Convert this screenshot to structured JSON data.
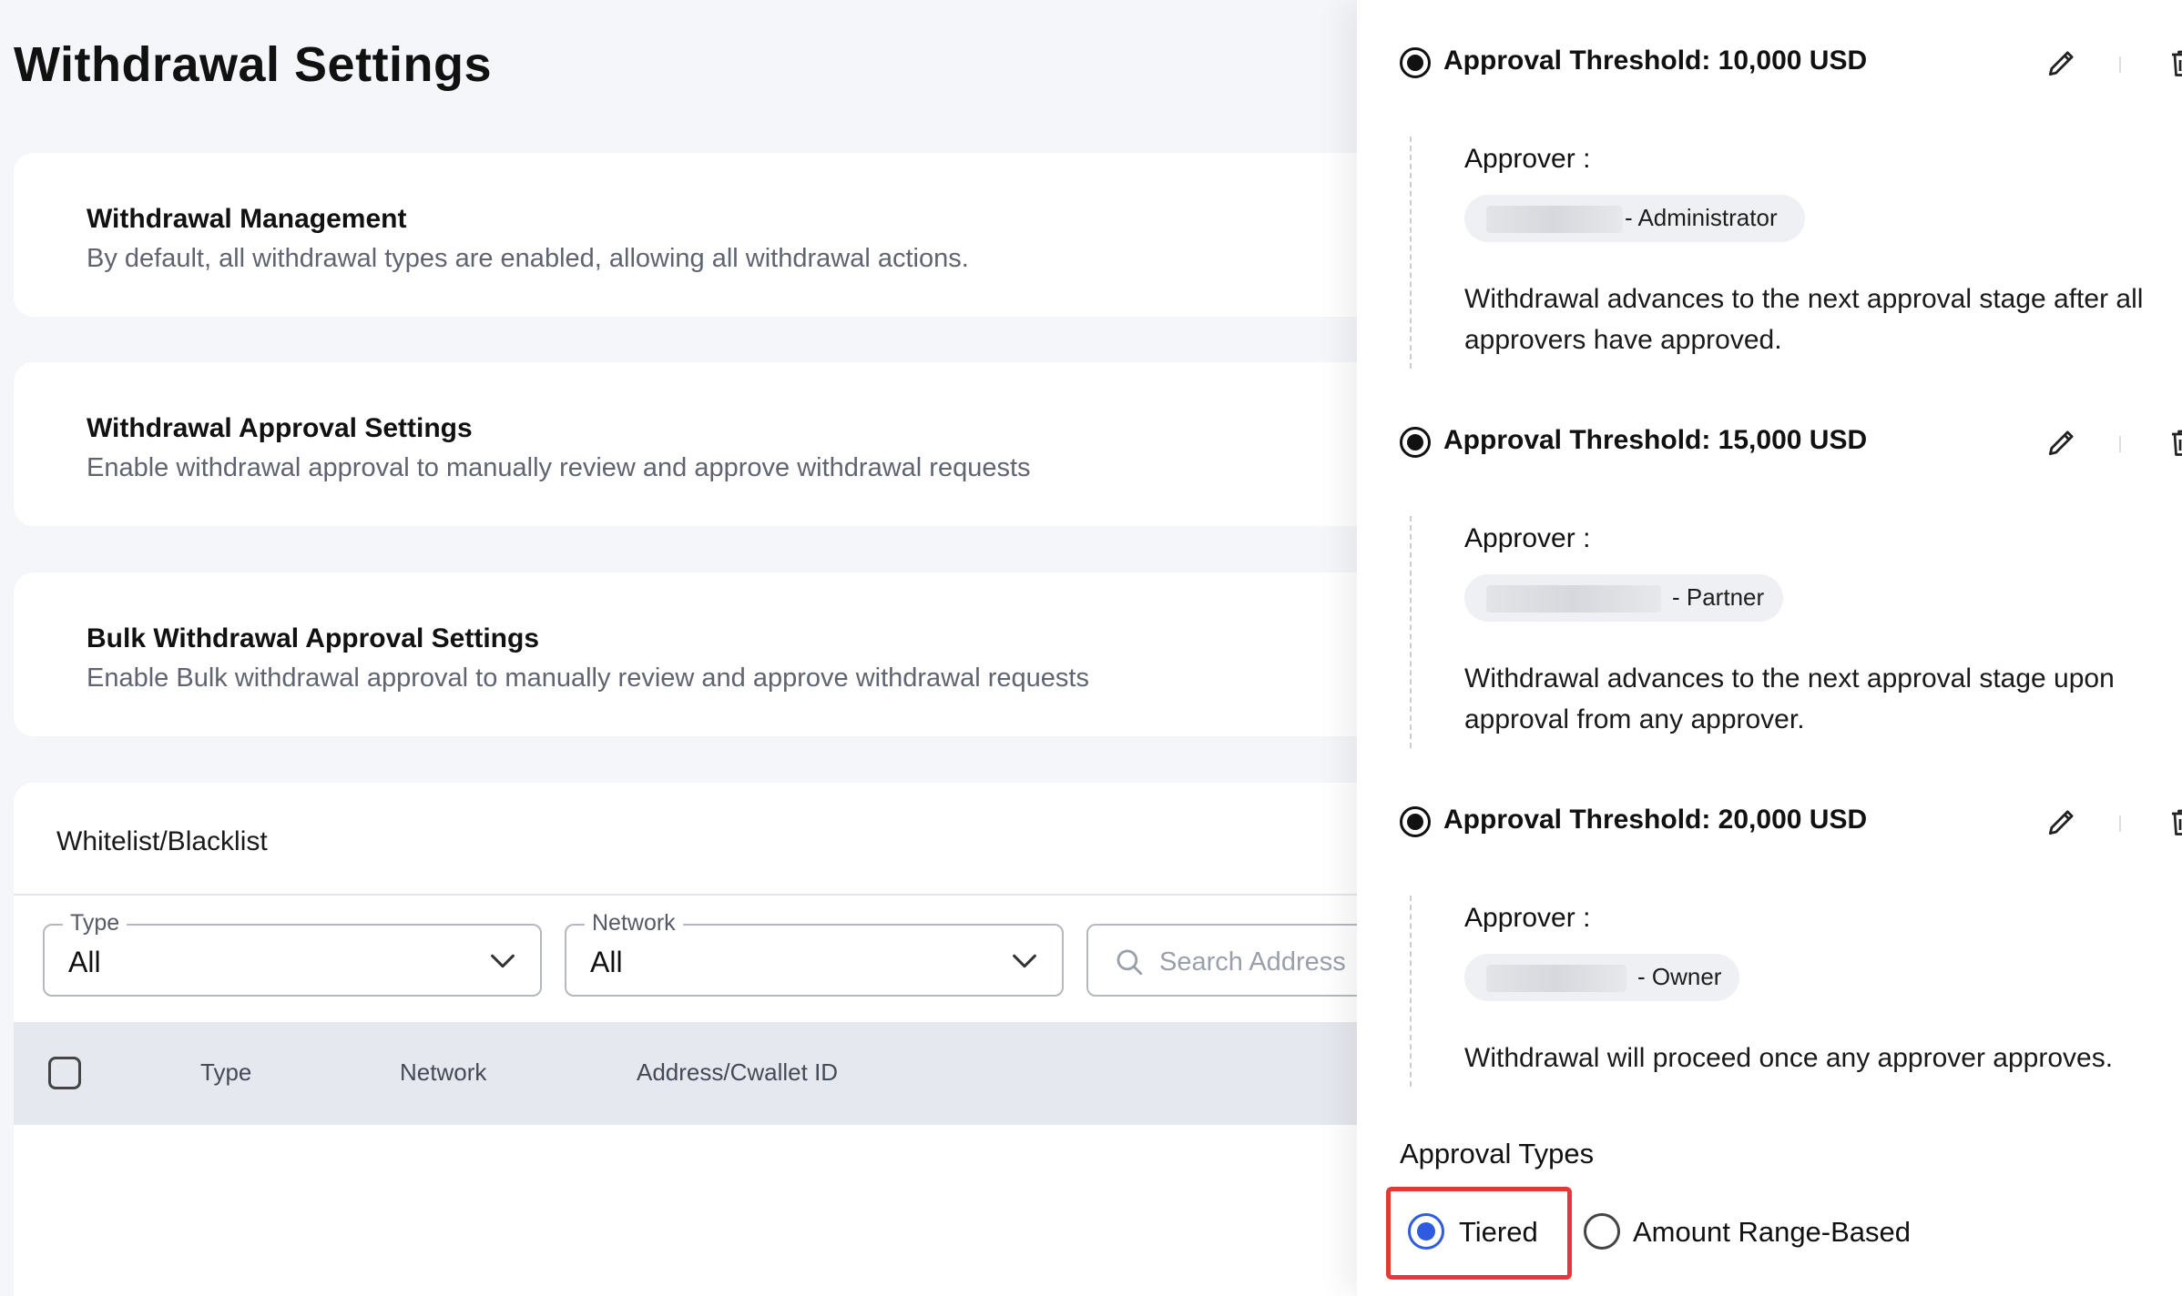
{
  "page": {
    "title": "Withdrawal Settings"
  },
  "cards": [
    {
      "title": "Withdrawal Management",
      "description": "By default, all withdrawal types are enabled, allowing all withdrawal actions."
    },
    {
      "title": "Withdrawal Approval Settings",
      "description": "Enable withdrawal approval to manually review and approve withdrawal requests"
    },
    {
      "title": "Bulk Withdrawal Approval Settings",
      "description": "Enable Bulk withdrawal approval to manually review and approve withdrawal requests"
    }
  ],
  "whitelist": {
    "title": "Whitelist/Blacklist",
    "filters": {
      "type": {
        "label": "Type",
        "value": "All"
      },
      "network": {
        "label": "Network",
        "value": "All"
      },
      "search_placeholder": "Search Address"
    },
    "columns": [
      "Type",
      "Network",
      "Address/Cwallet ID"
    ]
  },
  "approval_rules": [
    {
      "threshold": "Approval Threshold: 10,000 USD",
      "approver_label": "Approver :",
      "approver_role": "- Administrator",
      "description": "Withdrawal advances to the next approval stage after all approvers have approved."
    },
    {
      "threshold": "Approval Threshold: 15,000 USD",
      "approver_label": "Approver :",
      "approver_role": "- Partner",
      "description": "Withdrawal advances to the next approval stage upon approval from any approver."
    },
    {
      "threshold": "Approval Threshold: 20,000 USD",
      "approver_label": "Approver :",
      "approver_role": "- Owner",
      "description": "Withdrawal will proceed once any approver approves."
    }
  ],
  "approval_types": {
    "label": "Approval Types",
    "options": [
      {
        "label": "Tiered",
        "selected": true
      },
      {
        "label": "Amount Range-Based",
        "selected": false
      }
    ]
  },
  "colors": {
    "accent": "#2f5be0",
    "highlight": "#e53935",
    "table_header": "#e6e8ef"
  },
  "icons": [
    "chevron-down-icon",
    "search-icon",
    "pencil-icon",
    "trash-icon"
  ]
}
